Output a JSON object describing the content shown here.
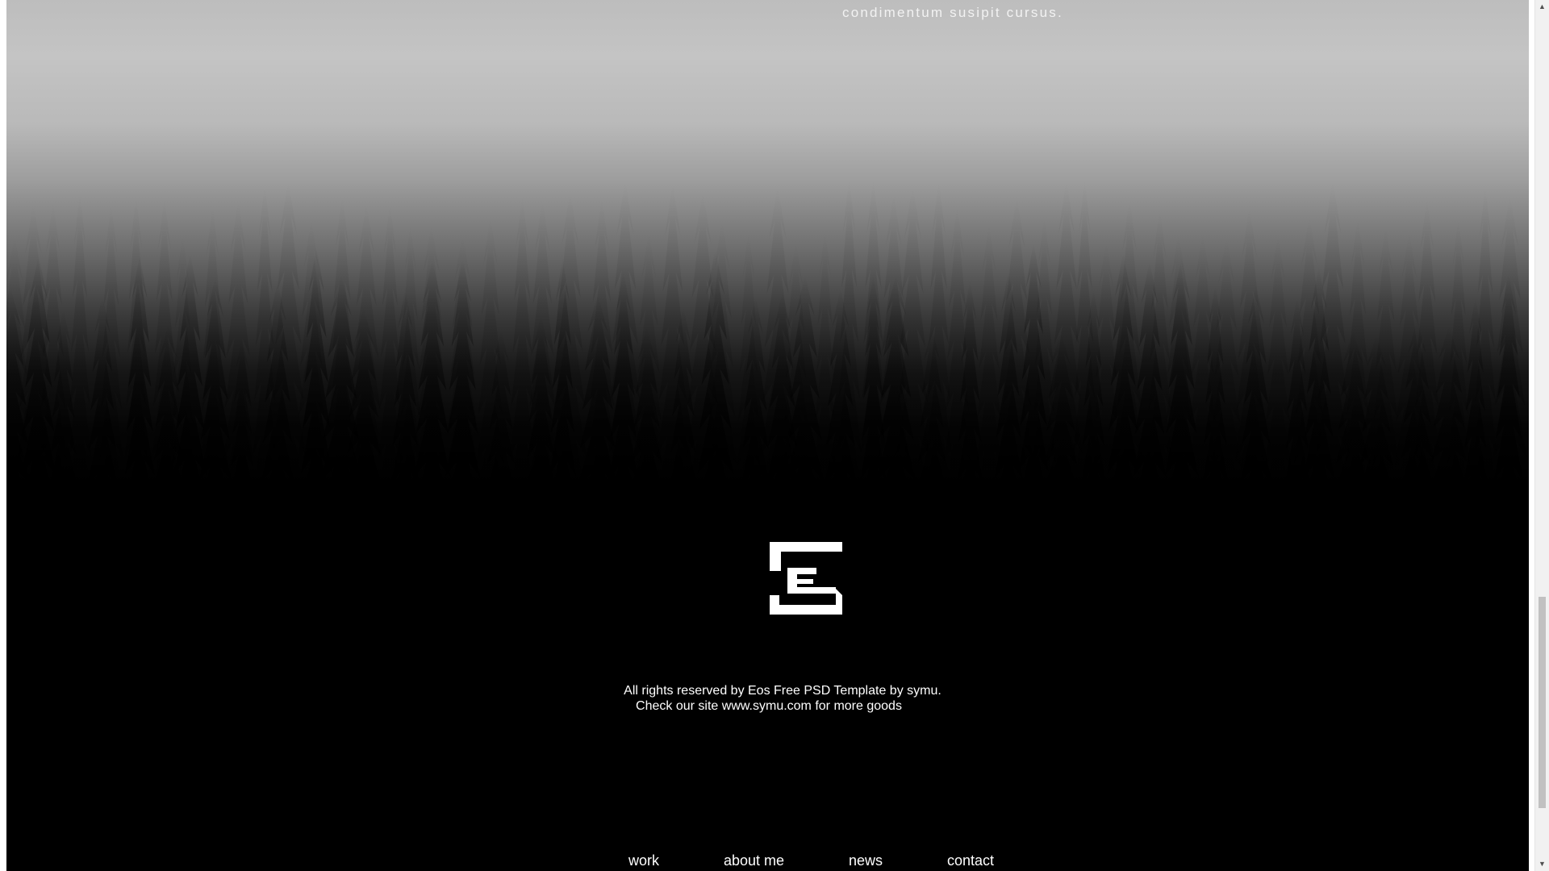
{
  "hero": {
    "caption": "condimentum susipit cursus.",
    "image_icon": "foggy-forest-image"
  },
  "logo": {
    "icon": "eos-logo-icon"
  },
  "footer": {
    "copyright_line1": "All rights reserved by Eos Free PSD Template by symu.",
    "copyright_line2": "Check our site www.symu.com for more goods"
  },
  "nav": {
    "items": [
      {
        "label": "work"
      },
      {
        "label": "about me"
      },
      {
        "label": "news"
      },
      {
        "label": "contact"
      }
    ]
  },
  "scrollbar": {
    "up_icon": "scroll-up-arrow-icon",
    "down_icon": "scroll-down-arrow-icon"
  },
  "colors": {
    "background": "#000000",
    "text": "#ffffff",
    "fog": "#bdbdbd"
  }
}
